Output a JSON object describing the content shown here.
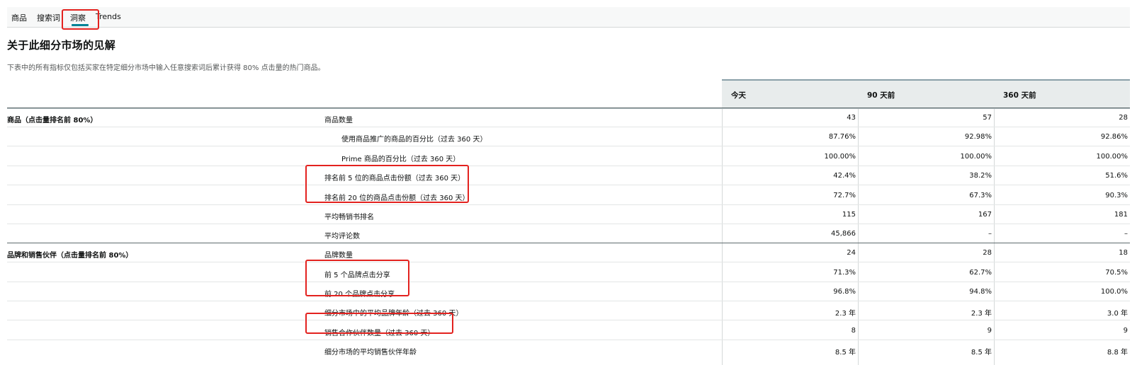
{
  "tabs": [
    {
      "label": "商品"
    },
    {
      "label": "搜索词"
    },
    {
      "label": "洞察"
    },
    {
      "label": "Trends"
    }
  ],
  "active_tab": "洞察",
  "title": "关于此细分市场的见解",
  "description": "下表中的所有指标仅包括买家在特定细分市场中输入任意搜索词后累计获得 80% 点击量的热门商品。",
  "columns": [
    "今天",
    "90 天前",
    "360 天前"
  ],
  "sections": [
    {
      "label": "商品（点击量排名前 80%）"
    },
    {
      "label": "品牌和销售伙伴（点击量排名前 80%）"
    }
  ],
  "rows": [
    {
      "metric": "商品数量",
      "today": "43",
      "d90": "57",
      "d360": "28"
    },
    {
      "metric": "使用商品推广的商品的百分比（过去 360 天）",
      "today": "87.76%",
      "d90": "92.98%",
      "d360": "92.86%"
    },
    {
      "metric": "Prime 商品的百分比（过去 360 天）",
      "today": "100.00%",
      "d90": "100.00%",
      "d360": "100.00%"
    },
    {
      "metric": "排名前 5 位的商品点击份额（过去 360 天）",
      "today": "42.4%",
      "d90": "38.2%",
      "d360": "51.6%"
    },
    {
      "metric": "排名前 20 位的商品点击份额（过去 360 天）",
      "today": "72.7%",
      "d90": "67.3%",
      "d360": "90.3%"
    },
    {
      "metric": "平均畅销书排名",
      "today": "115",
      "d90": "167",
      "d360": "181"
    },
    {
      "metric": "平均评论数",
      "today": "45,866",
      "d90": "–",
      "d360": "–"
    },
    {
      "metric": "品牌数量",
      "today": "24",
      "d90": "28",
      "d360": "18"
    },
    {
      "metric": "前 5 个品牌点击分享",
      "today": "71.3%",
      "d90": "62.7%",
      "d360": "70.5%"
    },
    {
      "metric": "前 20 个品牌点击分享",
      "today": "96.8%",
      "d90": "94.8%",
      "d360": "100.0%"
    },
    {
      "metric": "细分市场中的平均品牌年龄（过去 360 天）",
      "today": "2.3 年",
      "d90": "2.3 年",
      "d360": "3.0 年"
    },
    {
      "metric": "销售合作伙伴数量（过去 360 天）",
      "today": "8",
      "d90": "9",
      "d360": "9"
    },
    {
      "metric": "细分市场的平均销售伙伴年龄",
      "today": "8.5 年",
      "d90": "8.5 年",
      "d360": "8.8 年"
    }
  ],
  "colors": {
    "accent": "#008296",
    "highlight": "#e3221f",
    "header_bg": "#e8ecec"
  }
}
